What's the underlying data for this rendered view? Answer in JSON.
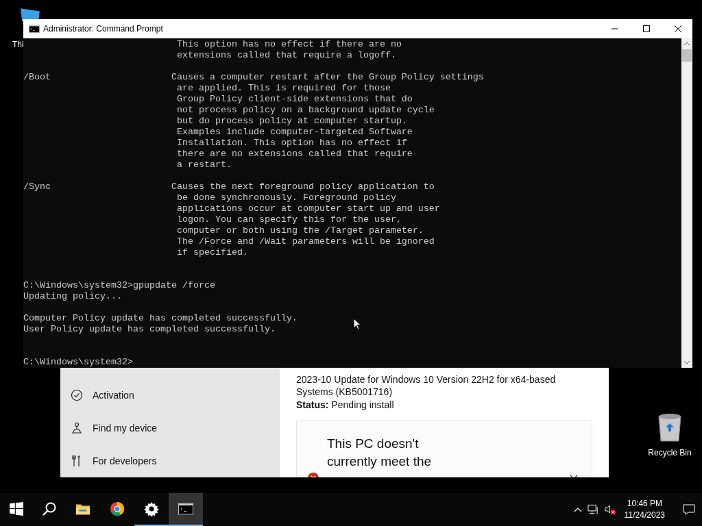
{
  "desktop": {
    "icons": [
      {
        "kind": "this-pc",
        "label": "Thi"
      },
      {
        "kind": "recycle-bin",
        "label": "Recycle Bin"
      }
    ]
  },
  "settings_window": {
    "nav_items": [
      {
        "kind": "activation",
        "label": "Activation"
      },
      {
        "kind": "find-device",
        "label": "Find my device"
      },
      {
        "kind": "developers",
        "label": "For developers"
      }
    ],
    "update": {
      "title": "2023-10 Update for Windows 10 Version 22H2 for x64-based Systems (KB5001716)",
      "status_label": "Status:",
      "status": "Pending install"
    },
    "notice": {
      "text": "This PC doesn't currently meet the"
    }
  },
  "console_window": {
    "title": "Administrator: Command Prompt",
    "output": [
      "                            This option has no effect if there are no\n                            extensions called that require a logoff.",
      "/Boot                      Causes a computer restart after the Group Policy settings\n                            are applied. This is required for those\n                            Group Policy client-side extensions that do\n                            not process policy on a background update cycle\n                            but do process policy at computer startup.\n                            Examples include computer-targeted Software\n                            Installation. This option has no effect if\n                            there are no extensions called that require\n                            a restart.",
      "/Sync                      Causes the next foreground policy application to\n                            be done synchronously. Foreground policy\n                            applications occur at computer start up and user\n                            logon. You can specify this for the user,\n                            computer or both using the /Target parameter.\n                            The /Force and /Wait parameters will be ignored\n                            if specified.",
      "\nC:\\Windows\\system32>gpupdate /force\nUpdating policy...",
      "Computer Policy update has completed successfully.\nUser Policy update has completed successfully.",
      "\nC:\\Windows\\system32>"
    ]
  },
  "taskbar": {
    "apps": [
      {
        "kind": "start",
        "running": false,
        "selected": false
      },
      {
        "kind": "search",
        "running": false,
        "selected": false
      },
      {
        "kind": "explorer",
        "running": false,
        "selected": false
      },
      {
        "kind": "chrome",
        "running": false,
        "selected": false
      },
      {
        "kind": "settings",
        "running": true,
        "selected": false
      },
      {
        "kind": "cmd",
        "running": true,
        "selected": true
      }
    ],
    "clock": {
      "time": "10:46 PM",
      "date": "11/24/2023"
    }
  }
}
